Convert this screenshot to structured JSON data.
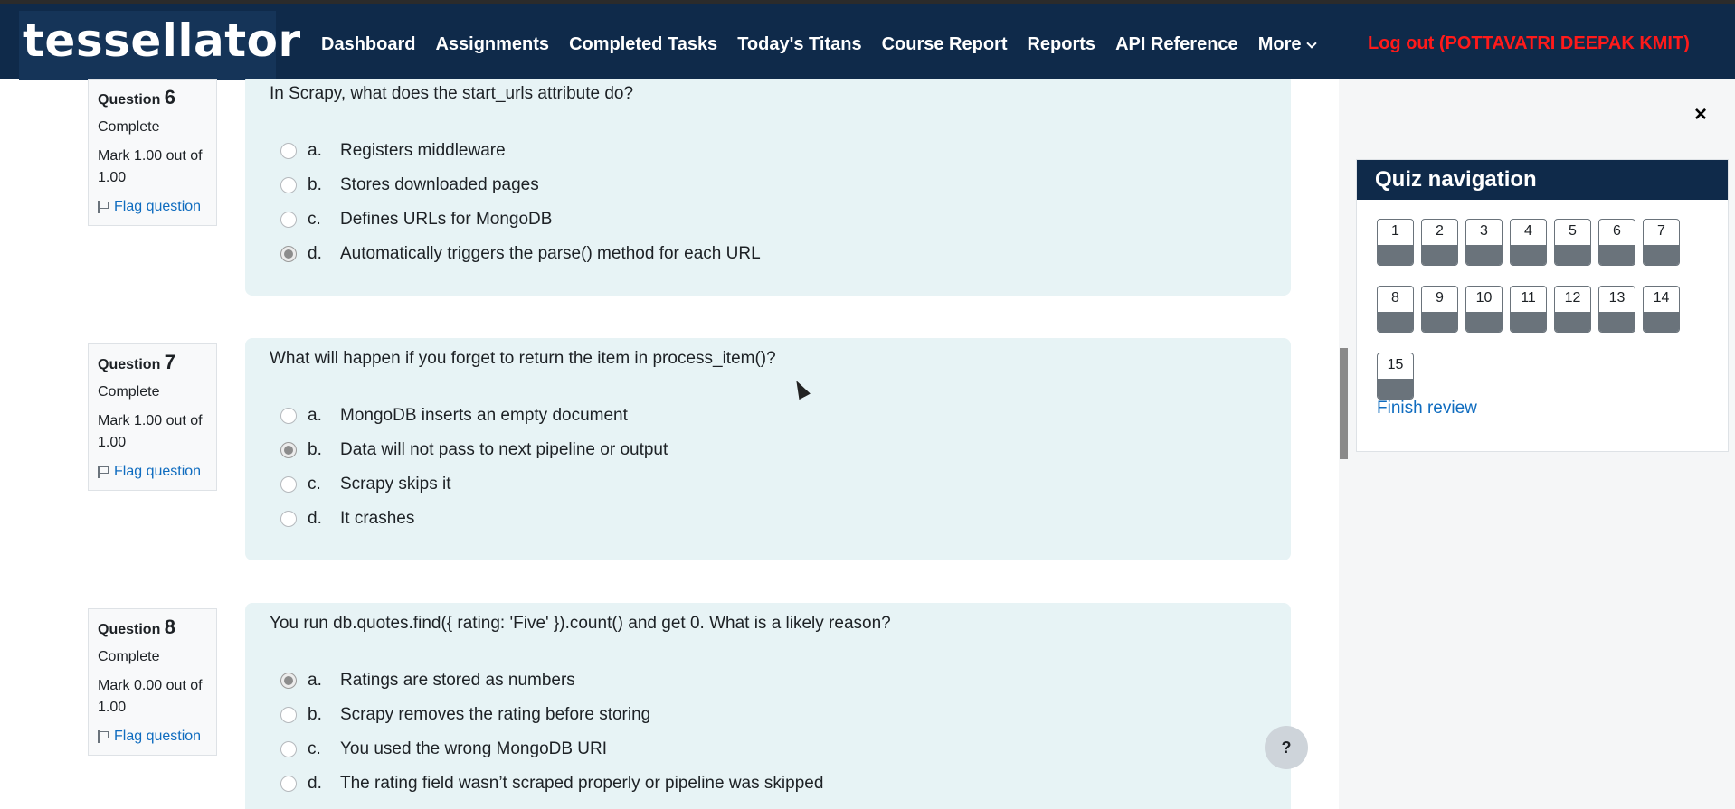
{
  "header": {
    "logo_text": "tessellator",
    "nav": [
      "Dashboard",
      "Assignments",
      "Completed Tasks",
      "Today's Titans",
      "Course Report",
      "Reports",
      "API Reference",
      "More"
    ],
    "logout": "Log out (POTTAVATRI DEEPAK KMIT)"
  },
  "questions": [
    {
      "label": "Question",
      "number": "6",
      "state": "Complete",
      "mark": "Mark 1.00 out of 1.00",
      "flag": "Flag question",
      "text": "In Scrapy, what does the start_urls attribute do?",
      "answers": [
        {
          "letter": "a.",
          "text": "Registers middleware",
          "selected": false
        },
        {
          "letter": "b.",
          "text": "Stores downloaded pages",
          "selected": false
        },
        {
          "letter": "c.",
          "text": "Defines URLs for MongoDB",
          "selected": false
        },
        {
          "letter": "d.",
          "text": "Automatically triggers the parse() method for each URL",
          "selected": true
        }
      ]
    },
    {
      "label": "Question",
      "number": "7",
      "state": "Complete",
      "mark": "Mark 1.00 out of 1.00",
      "flag": "Flag question",
      "text": "What will happen if you forget to return the item in process_item()?",
      "answers": [
        {
          "letter": "a.",
          "text": "MongoDB inserts an empty document",
          "selected": false
        },
        {
          "letter": "b.",
          "text": "Data will not pass to next pipeline or output",
          "selected": true
        },
        {
          "letter": "c.",
          "text": "Scrapy skips it",
          "selected": false
        },
        {
          "letter": "d.",
          "text": "It crashes",
          "selected": false
        }
      ]
    },
    {
      "label": "Question",
      "number": "8",
      "state": "Complete",
      "mark": "Mark 0.00 out of 1.00",
      "flag": "Flag question",
      "text": "You run db.quotes.find({ rating: 'Five' }).count() and get 0. What is a likely reason?",
      "answers": [
        {
          "letter": "a.",
          "text": "Ratings are stored as numbers",
          "selected": true
        },
        {
          "letter": "b.",
          "text": "Scrapy removes the rating before storing",
          "selected": false
        },
        {
          "letter": "c.",
          "text": "You used the wrong MongoDB URI",
          "selected": false
        },
        {
          "letter": "d.",
          "text": "The rating field wasn’t scraped properly or pipeline was skipped",
          "selected": false
        }
      ]
    }
  ],
  "quiz_nav": {
    "title": "Quiz navigation",
    "close": "×",
    "buttons": [
      "1",
      "2",
      "3",
      "4",
      "5",
      "6",
      "7",
      "8",
      "9",
      "10",
      "11",
      "12",
      "13",
      "14",
      "15"
    ],
    "finish": "Finish review"
  },
  "help": "?"
}
